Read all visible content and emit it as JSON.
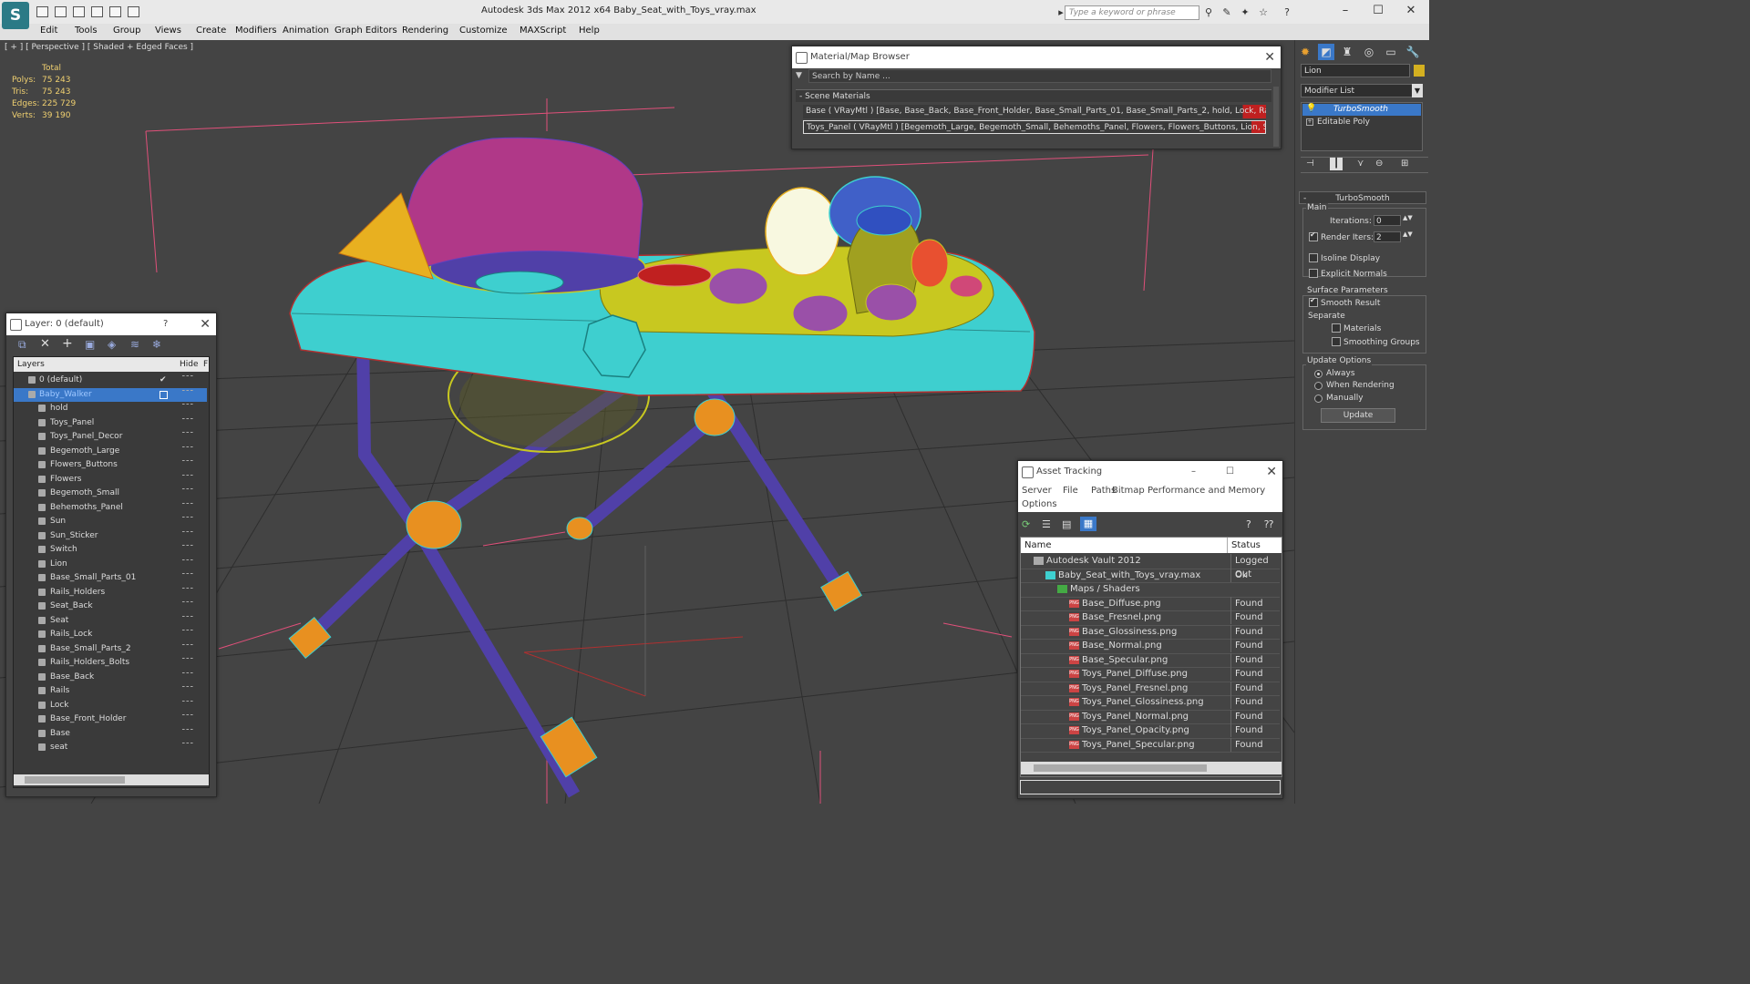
{
  "titlebar": {
    "title": "Autodesk 3ds Max  2012 x64      Baby_Seat_with_Toys_vray.max",
    "search_placeholder": "Type a keyword or phrase"
  },
  "menu": [
    "Edit",
    "Tools",
    "Group",
    "Views",
    "Create",
    "Modifiers",
    "Animation",
    "Graph Editors",
    "Rendering",
    "Customize",
    "MAXScript",
    "Help"
  ],
  "viewport": {
    "label": "[ + ] [ Perspective ] [ Shaded + Edged Faces ]",
    "stats": {
      "header": "Total",
      "rows": [
        {
          "label": "Polys:",
          "value": "75 243"
        },
        {
          "label": "Tris:",
          "value": "75 243"
        },
        {
          "label": "Edges:",
          "value": "225 729"
        },
        {
          "label": "Verts:",
          "value": "39 190"
        }
      ]
    }
  },
  "material_browser": {
    "title": "Material/Map Browser",
    "search_placeholder": "Search by Name ...",
    "section": "- Scene Materials",
    "materials": [
      "Base  ( VRayMtl ) [Base, Base_Back, Base_Front_Holder, Base_Small_Parts_01, Base_Small_Parts_2, hold, Lock, Rails,...",
      "Toys_Panel  ( VRayMtl ) [Begemoth_Large, Begemoth_Small, Behemoths_Panel, Flowers, Flowers_Buttons, Lion, Sun, S..."
    ]
  },
  "layer_window": {
    "title": "Layer: 0 (default)",
    "help": "?",
    "col_layers": "Layers",
    "col_hide": "Hide",
    "col_f": "F",
    "top_layers": [
      "0 (default)",
      "Baby_Walker"
    ],
    "objects": [
      "hold",
      "Toys_Panel",
      "Toys_Panel_Decor",
      "Begemoth_Large",
      "Flowers_Buttons",
      "Flowers",
      "Begemoth_Small",
      "Behemoths_Panel",
      "Sun",
      "Sun_Sticker",
      "Switch",
      "Lion",
      "Base_Small_Parts_01",
      "Rails_Holders",
      "Seat_Back",
      "Seat",
      "Rails_Lock",
      "Base_Small_Parts_2",
      "Rails_Holders_Bolts",
      "Base_Back",
      "Rails",
      "Lock",
      "Base_Front_Holder",
      "Base",
      "seat"
    ]
  },
  "asset_tracking": {
    "title": "Asset Tracking",
    "menu": [
      "Server",
      "File",
      "Paths",
      "Bitmap Performance and Memory",
      "Options"
    ],
    "col_name": "Name",
    "col_status": "Status",
    "rows": [
      {
        "name": "Autodesk Vault 2012",
        "status": "Logged Out",
        "indent": 1,
        "icon": "vault"
      },
      {
        "name": "Baby_Seat_with_Toys_vray.max",
        "status": "Ok",
        "indent": 2,
        "icon": "max"
      },
      {
        "name": "Maps / Shaders",
        "status": "",
        "indent": 3,
        "icon": "folder"
      },
      {
        "name": "Base_Diffuse.png",
        "status": "Found",
        "indent": 4,
        "icon": "png"
      },
      {
        "name": "Base_Fresnel.png",
        "status": "Found",
        "indent": 4,
        "icon": "png"
      },
      {
        "name": "Base_Glossiness.png",
        "status": "Found",
        "indent": 4,
        "icon": "png"
      },
      {
        "name": "Base_Normal.png",
        "status": "Found",
        "indent": 4,
        "icon": "png"
      },
      {
        "name": "Base_Specular.png",
        "status": "Found",
        "indent": 4,
        "icon": "png"
      },
      {
        "name": "Toys_Panel_Diffuse.png",
        "status": "Found",
        "indent": 4,
        "icon": "png"
      },
      {
        "name": "Toys_Panel_Fresnel.png",
        "status": "Found",
        "indent": 4,
        "icon": "png"
      },
      {
        "name": "Toys_Panel_Glossiness.png",
        "status": "Found",
        "indent": 4,
        "icon": "png"
      },
      {
        "name": "Toys_Panel_Normal.png",
        "status": "Found",
        "indent": 4,
        "icon": "png"
      },
      {
        "name": "Toys_Panel_Opacity.png",
        "status": "Found",
        "indent": 4,
        "icon": "png"
      },
      {
        "name": "Toys_Panel_Specular.png",
        "status": "Found",
        "indent": 4,
        "icon": "png"
      }
    ]
  },
  "command_panel": {
    "object_name": "Lion",
    "object_color": "#d4b020",
    "modifier_list": "Modifier List",
    "stack": [
      {
        "name": "TurboSmooth",
        "selected": true
      },
      {
        "name": "Editable Poly",
        "selected": false
      }
    ],
    "rollout_title": "TurboSmooth",
    "main_group": "Main",
    "iterations_label": "Iterations:",
    "iterations_value": "0",
    "render_iters_label": "Render Iters:",
    "render_iters_value": "2",
    "isoline_label": "Isoline Display",
    "explicit_normals_label": "Explicit Normals",
    "surface_group": "Surface Parameters",
    "smooth_result_label": "Smooth Result",
    "separate_label": "Separate",
    "materials_label": "Materials",
    "smoothing_groups_label": "Smoothing Groups",
    "update_group": "Update Options",
    "always_label": "Always",
    "when_rendering_label": "When Rendering",
    "manually_label": "Manually",
    "update_button": "Update"
  },
  "colors": {
    "accent": "#3a78c8",
    "wire_cyan": "#3ecfcf",
    "wire_yellow": "#c8c820",
    "wire_purple": "#5040a8",
    "wire_orange": "#e89020",
    "wire_magenta": "#b03888",
    "grid": "#2e2e2e"
  }
}
